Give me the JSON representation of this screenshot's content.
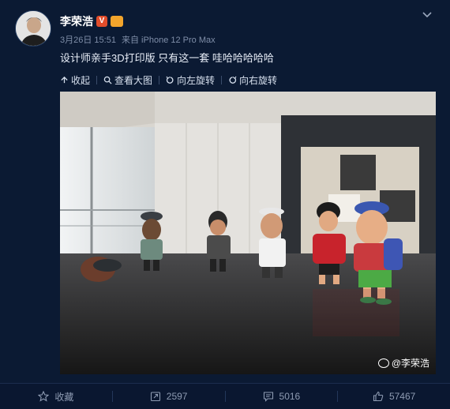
{
  "user": {
    "name": "李荣浩",
    "badges": [
      "vip-v-icon",
      "crown-icon"
    ]
  },
  "meta": {
    "date": "3月26日 15:51",
    "source": "来自 iPhone 12 Pro Max"
  },
  "post": {
    "text": "设计师亲手3D打印版  只有这一套  哇哈哈哈哈哈"
  },
  "toolbar": {
    "collapse": "收起",
    "view_large": "查看大图",
    "rotate_left": "向左旋转",
    "rotate_right": "向右旋转"
  },
  "photo": {
    "watermark": "@李荣浩"
  },
  "footer": {
    "favorite": "收藏",
    "reposts": "2597",
    "comments": "5016",
    "likes": "57467"
  },
  "colors": {
    "background": "#0b1a33",
    "accent_badge": "#e24d2b"
  }
}
